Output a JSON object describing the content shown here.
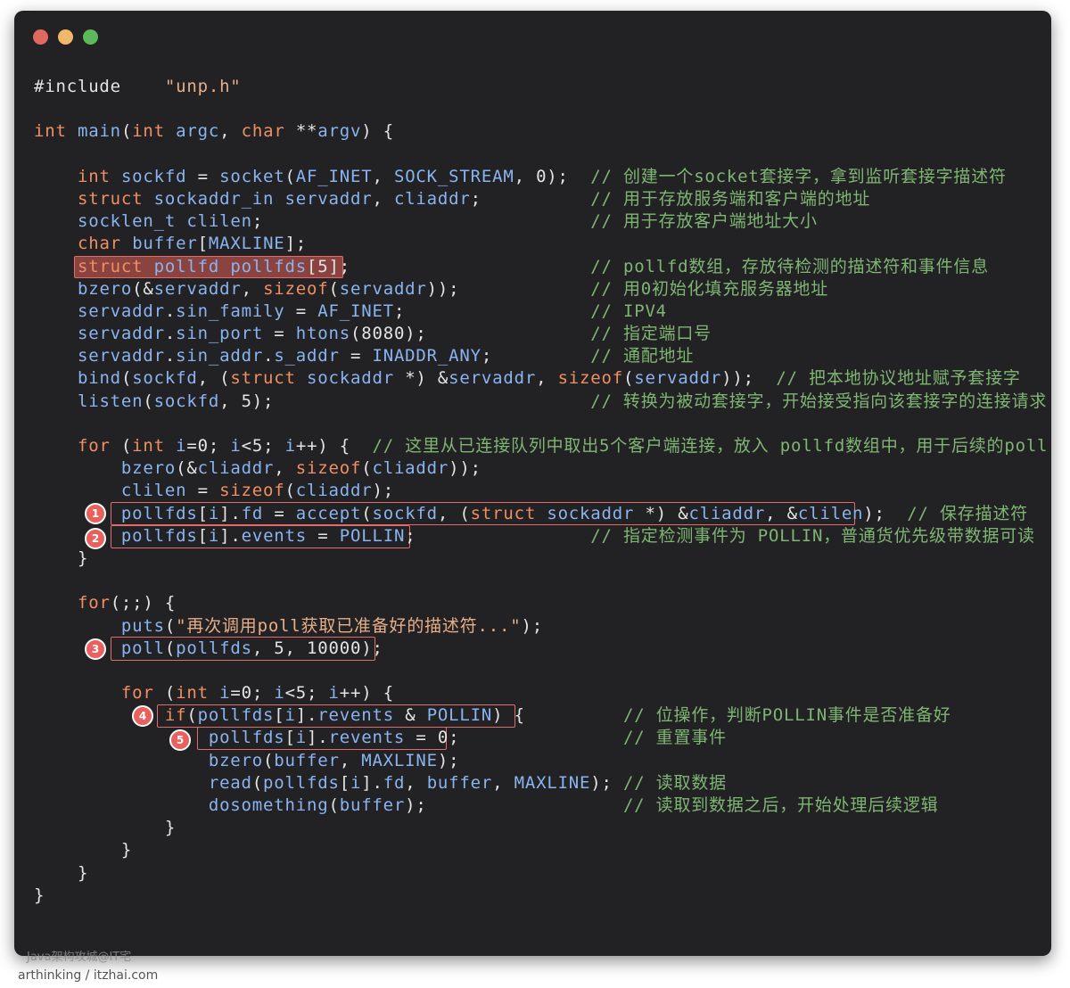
{
  "window": {
    "controls": [
      "close-button",
      "minimize-button",
      "zoom-button"
    ],
    "colors": {
      "background": "#222224",
      "text": "#e4e4e4",
      "keyword": "#ef8f63",
      "identifier": "#89b4f0",
      "string": "#e7ae88",
      "comment": "#7fb573",
      "highlight": "#e06c6c"
    }
  },
  "code": {
    "lines": [
      "#include    \"unp.h\"",
      "",
      "int main(int argc, char **argv) {",
      "",
      "    int sockfd = socket(AF_INET, SOCK_STREAM, 0);  // 创建一个socket套接字，拿到监听套接字描述符",
      "    struct sockaddr_in servaddr, cliaddr;          // 用于存放服务端和客户端的地址",
      "    socklen_t clilen;                              // 用于存放客户端地址大小",
      "    char buffer[MAXLINE];",
      "    struct pollfd pollfds[5];                      // pollfd数组，存放待检测的描述符和事件信息",
      "    bzero(&servaddr, sizeof(servaddr));            // 用0初始化填充服务器地址",
      "    servaddr.sin_family = AF_INET;                 // IPV4",
      "    servaddr.sin_port = htons(8080);               // 指定端口号",
      "    servaddr.sin_addr.s_addr = INADDR_ANY;         // 通配地址",
      "    bind(sockfd, (struct sockaddr *) &servaddr, sizeof(servaddr));  // 把本地协议地址赋予套接字",
      "    listen(sockfd, 5);                             // 转换为被动套接字，开始接受指向该套接字的连接请求",
      "",
      "    for (int i=0; i<5; i++) {  // 这里从已连接队列中取出5个客户端连接，放入 pollfd数组中，用于后续的poll",
      "        bzero(&cliaddr, sizeof(cliaddr));",
      "        clilen = sizeof(cliaddr);",
      "        pollfds[i].fd = accept(sockfd, (struct sockaddr *) &cliaddr, &clilen);  // 保存描述符",
      "        pollfds[i].events = POLLIN;                // 指定检测事件为 POLLIN，普通货优先级带数据可读",
      "    }",
      "",
      "    for(;;) {",
      "        puts(\"再次调用poll获取已准备好的描述符...\");",
      "        poll(pollfds, 5, 10000);",
      "",
      "        for (int i=0; i<5; i++) {",
      "            if(pollfds[i].revents & POLLIN) {         // 位操作，判断POLLIN事件是否准备好",
      "                pollfds[i].revents = 0;               // 重置事件",
      "                bzero(buffer, MAXLINE);",
      "                read(pollfds[i].fd, buffer, MAXLINE); // 读取数据",
      "                dosomething(buffer);                  // 读取到数据之后，开始处理后续逻辑",
      "            }",
      "        }",
      "    }",
      "}"
    ]
  },
  "annotations": [
    "1",
    "2",
    "3",
    "4",
    "5"
  ],
  "watermark": "Java架构攻城@IT宅",
  "credit": "arthinking / itzhai.com"
}
